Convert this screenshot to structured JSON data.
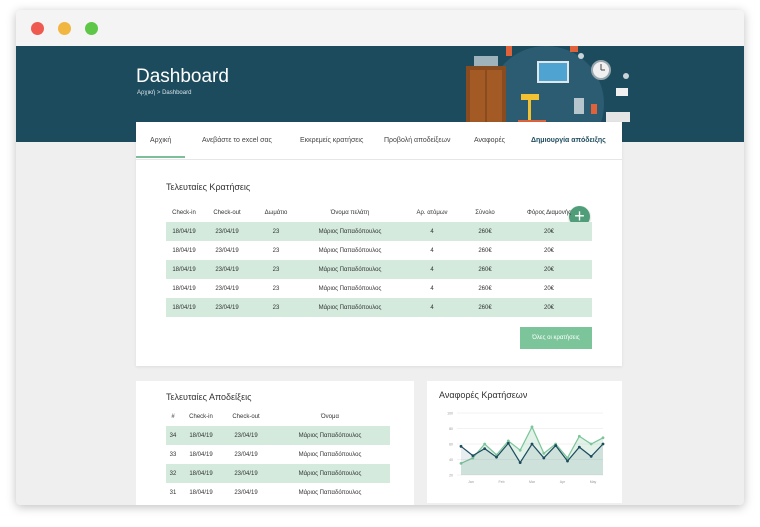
{
  "header": {
    "title": "Dashboard",
    "breadcrumb": "Αρχική > Dashboard"
  },
  "tabs": [
    {
      "label": "Αρχική"
    },
    {
      "label": "Ανεβάστε το excel σας"
    },
    {
      "label": "Εκκρεμείς κρατήσεις"
    },
    {
      "label": "Προβολή αποδείξεων"
    },
    {
      "label": "Αναφορές"
    },
    {
      "label": "Δημιουργία απόδειξης"
    }
  ],
  "bookings": {
    "title": "Τελευταίες Κρατήσεις",
    "columns": [
      "Check-in",
      "Check-out",
      "Δωμάτιο",
      "Όνομα πελάτη",
      "Αρ. ατόμων",
      "Σύνολο",
      "Φόρος Διαμονής"
    ],
    "rows": [
      [
        "18/04/19",
        "23/04/19",
        "23",
        "Μάριος Παπαδόπουλος",
        "4",
        "260€",
        "20€"
      ],
      [
        "18/04/19",
        "23/04/19",
        "23",
        "Μάριος Παπαδόπουλος",
        "4",
        "260€",
        "20€"
      ],
      [
        "18/04/19",
        "23/04/19",
        "23",
        "Μάριος Παπαδόπουλος",
        "4",
        "260€",
        "20€"
      ],
      [
        "18/04/19",
        "23/04/19",
        "23",
        "Μάριος Παπαδόπουλος",
        "4",
        "260€",
        "20€"
      ],
      [
        "18/04/19",
        "23/04/19",
        "23",
        "Μάριος Παπαδόπουλος",
        "4",
        "260€",
        "20€"
      ]
    ],
    "add_button": "+",
    "all_button": "Όλες οι κρατήσεις"
  },
  "receipts": {
    "title": "Τελευταίες Αποδείξεις",
    "columns": [
      "#",
      "Check-in",
      "Check-out",
      "Όνομα"
    ],
    "rows": [
      [
        "34",
        "18/04/19",
        "23/04/19",
        "Μάριος Παπαδόπουλος"
      ],
      [
        "33",
        "18/04/19",
        "23/04/19",
        "Μάριος Παπαδόπουλος"
      ],
      [
        "32",
        "18/04/19",
        "23/04/19",
        "Μάριος Παπαδόπουλος"
      ],
      [
        "31",
        "18/04/19",
        "23/04/19",
        "Μάριος Παπαδόπουλος"
      ]
    ]
  },
  "reports": {
    "title": "Αναφορές Κρατήσεων"
  },
  "colors": {
    "header_bg": "#1d4b5e",
    "accent_green": "#7cc59a",
    "row_green": "#d3eadc",
    "series_dark": "#1d4b5e",
    "series_light": "#7cc59a"
  },
  "chart_data": {
    "type": "line",
    "categories": [
      "Jan",
      "Feb",
      "Mar",
      "Apr",
      "May"
    ],
    "ytick_labels": [
      "100",
      "80",
      "60",
      "40",
      "20"
    ],
    "ylim": [
      20,
      100
    ],
    "series": [
      {
        "values": [
          57,
          45,
          54,
          43,
          61,
          36,
          60,
          42,
          58,
          38,
          56,
          44,
          60
        ]
      },
      {
        "values": [
          35,
          42,
          60,
          46,
          64,
          52,
          82,
          48,
          60,
          42,
          70,
          60,
          68
        ]
      }
    ]
  }
}
